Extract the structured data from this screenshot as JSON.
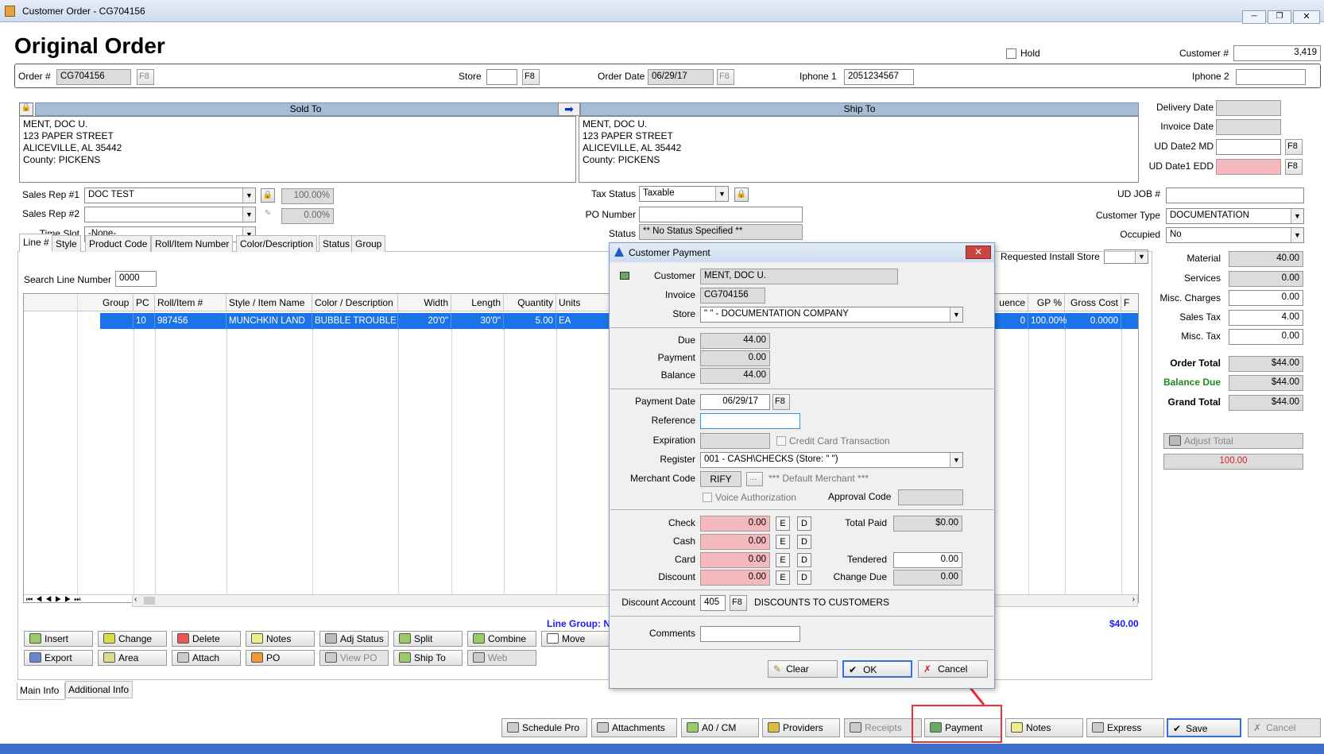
{
  "window": {
    "title": "Customer Order - CG704156"
  },
  "header": {
    "title": "Original Order",
    "hold_label": "Hold",
    "customer_no_label": "Customer #",
    "customer_no": "3,419"
  },
  "order_row": {
    "order_label": "Order #",
    "order_value": "CG704156",
    "f8": "F8",
    "store_label": "Store",
    "store_value": "",
    "order_date_label": "Order Date",
    "order_date": "06/29/17",
    "iphone1_label": "Iphone 1",
    "iphone1": "2051234567",
    "iphone2_label": "Iphone 2",
    "iphone2": ""
  },
  "sold_to": {
    "header": "Sold To",
    "lines": [
      "MENT, DOC U.",
      "123 PAPER STREET",
      "ALICEVILLE, AL  35442",
      "County: PICKENS"
    ]
  },
  "ship_to": {
    "header": "Ship To",
    "lines": [
      "MENT, DOC U.",
      "123 PAPER STREET",
      "ALICEVILLE, AL  35442",
      "County: PICKENS"
    ]
  },
  "dates": {
    "delivery_label": "Delivery Date",
    "invoice_label": "Invoice Date",
    "ud2_label": "UD Date2 MD",
    "ud1_label": "UD Date1 EDD"
  },
  "sales": {
    "rep1_label": "Sales Rep #1",
    "rep1": "DOC TEST",
    "rep1_pct": "100.00%",
    "rep2_label": "Sales Rep #2",
    "rep2": "",
    "rep2_pct": "0.00%",
    "timeslot_label": "Time Slot",
    "timeslot": "-None-"
  },
  "tax": {
    "status_label": "Tax Status",
    "status": "Taxable",
    "po_label": "PO Number",
    "po": "",
    "status2_label": "Status",
    "status2": "** No Status Specified **"
  },
  "right_info": {
    "udjob_label": "UD JOB #",
    "udjob": "",
    "cust_type_label": "Customer Type",
    "cust_type": "DOCUMENTATION",
    "occupied_label": "Occupied",
    "occupied": "No",
    "req_install_label": "Requested Install Store"
  },
  "totals": {
    "material_label": "Material",
    "material": "40.00",
    "services_label": "Services",
    "services": "0.00",
    "misc_charges_label": "Misc. Charges",
    "misc_charges": "0.00",
    "sales_tax_label": "Sales Tax",
    "sales_tax": "4.00",
    "misc_tax_label": "Misc. Tax",
    "misc_tax": "0.00",
    "order_total_label": "Order Total",
    "order_total": "$44.00",
    "balance_due_label": "Balance Due",
    "balance_due": "$44.00",
    "grand_total_label": "Grand Total",
    "grand_total": "$44.00",
    "adjust_total_label": "Adjust Total",
    "adjust_value": "100.00"
  },
  "tabs": [
    "Line #",
    "Style",
    "Product Code",
    "Roll/Item Number",
    "Color/Description",
    "Status",
    "Group"
  ],
  "search": {
    "label": "Search Line Number",
    "value": "0000"
  },
  "grid": {
    "headers": [
      "Group",
      "PC",
      "Roll/Item #",
      "Style / Item Name",
      "Color / Description",
      "Width",
      "Length",
      "Quantity",
      "Units"
    ],
    "right_headers": [
      "uence",
      "GP %",
      "Gross Cost",
      "F"
    ],
    "row": [
      "",
      "10",
      "987456",
      "MUNCHKIN LAND",
      "BUBBLE TROUBLE",
      "20'0\"",
      "30'0\"",
      "5.00",
      "EA"
    ],
    "row_right": [
      "0",
      "100.00%",
      "0.0000"
    ]
  },
  "line_group": {
    "label": "Line Group: NC",
    "amount": "$40.00"
  },
  "actions": [
    [
      "Insert",
      "Change",
      "Delete",
      "Notes",
      "Adj Status",
      "Split",
      "Combine",
      "Move"
    ],
    [
      "Export",
      "Area",
      "Attach",
      "PO",
      "View PO",
      "Ship To",
      "Web"
    ]
  ],
  "bottom_tabs": [
    "Main Info",
    "Additional Info"
  ],
  "footer": [
    "Schedule Pro",
    "Attachments",
    "A0 / CM",
    "Providers",
    "Receipts",
    "Payment",
    "Notes",
    "Express",
    "Save",
    "Cancel"
  ],
  "dialog": {
    "title": "Customer Payment",
    "customer_label": "Customer",
    "customer": "MENT, DOC U.",
    "invoice_label": "Invoice",
    "invoice": "CG704156",
    "store_label": "Store",
    "store": "\" \" - DOCUMENTATION COMPANY",
    "due_label": "Due",
    "due": "44.00",
    "payment_label": "Payment",
    "payment": "0.00",
    "balance_label": "Balance",
    "balance": "44.00",
    "payment_date_label": "Payment Date",
    "payment_date": "06/29/17",
    "f8": "F8",
    "reference_label": "Reference",
    "reference": "",
    "expiration_label": "Expiration",
    "credit_card_label": "Credit Card Transaction",
    "register_label": "Register",
    "register": "001 - CASH\\CHECKS (Store: \" \")",
    "merchant_label": "Merchant Code",
    "merchant": "RIFY",
    "ellipsis": "...",
    "default_merchant": "*** Default Merchant ***",
    "voice_label": "Voice Authorization",
    "approval_label": "Approval Code",
    "check_label": "Check",
    "check": "0.00",
    "cash_label": "Cash",
    "cash": "0.00",
    "card_label": "Card",
    "card": "0.00",
    "discount_label": "Discount",
    "discount": "0.00",
    "e": "E",
    "d": "D",
    "total_paid_label": "Total Paid",
    "total_paid": "$0.00",
    "tendered_label": "Tendered",
    "tendered": "0.00",
    "change_due_label": "Change Due",
    "change_due": "0.00",
    "discount_account_label": "Discount Account",
    "discount_account": "405",
    "discount_account_desc": "DISCOUNTS TO CUSTOMERS",
    "comments_label": "Comments",
    "comments": "",
    "clear": "Clear",
    "ok": "OK",
    "cancel": "Cancel"
  },
  "colors": {
    "title_bar": "#d6e3f3",
    "selected_row": "#1a73e8",
    "highlight": "#e8343a",
    "pink": "#f3b9bd",
    "link_blue": "#1a1aff",
    "green": "#1e8a1e",
    "red": "#e02020"
  }
}
